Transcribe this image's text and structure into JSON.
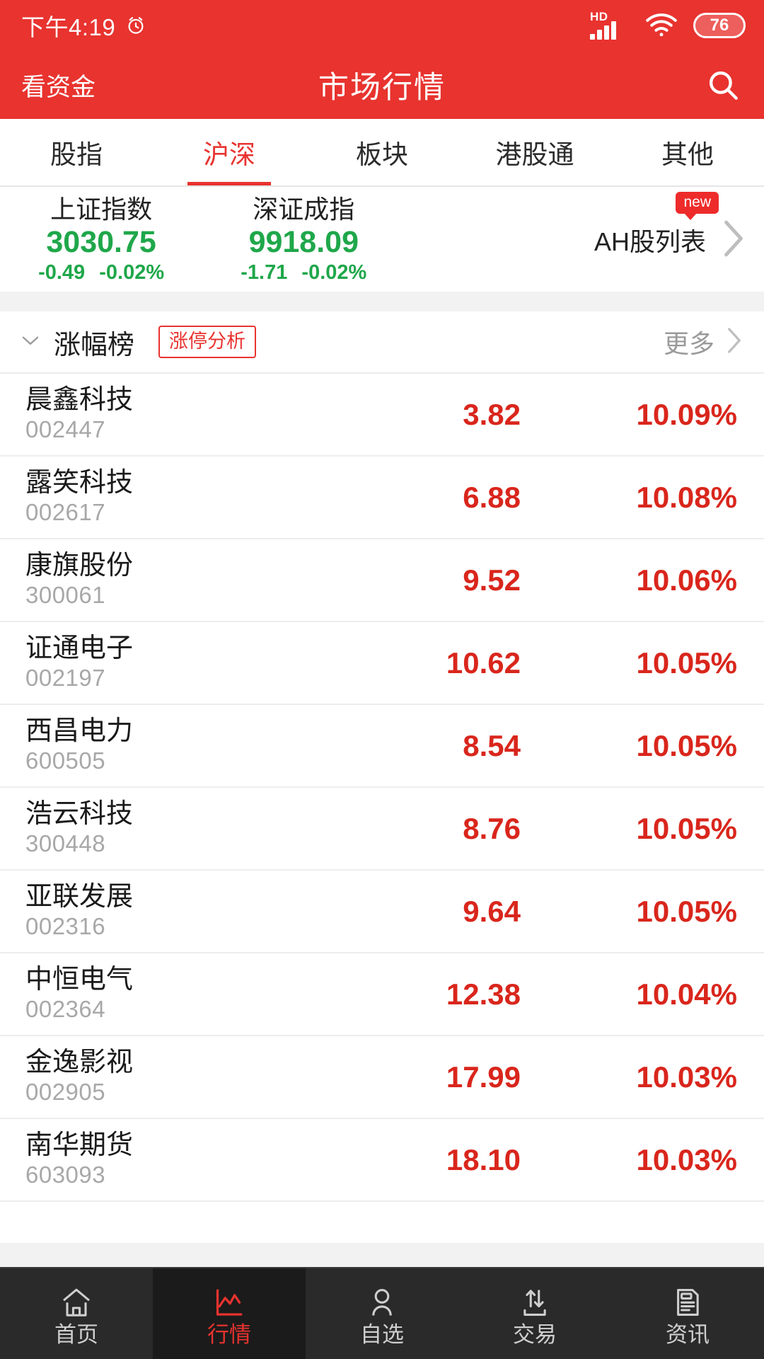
{
  "status_bar": {
    "time": "下午4:19",
    "alarm_icon": "alarm-clock-icon",
    "network_label": "HD",
    "signal_icon": "signal-bars-icon",
    "wifi_icon": "wifi-icon",
    "battery_level": "76"
  },
  "header": {
    "left_action": "看资金",
    "title": "市场行情",
    "search_icon": "search-icon",
    "background_color": "#E8332F"
  },
  "tabs": [
    {
      "label": "股指",
      "active": false
    },
    {
      "label": "沪深",
      "active": true
    },
    {
      "label": "板块",
      "active": false
    },
    {
      "label": "港股通",
      "active": false
    },
    {
      "label": "其他",
      "active": false
    }
  ],
  "indices": [
    {
      "name": "上证指数",
      "value": "3030.75",
      "change": "-0.49",
      "change_pct": "-0.02%",
      "direction": "down",
      "color": "#1FA74A"
    },
    {
      "name": "深证成指",
      "value": "9918.09",
      "change": "-1.71",
      "change_pct": "-0.02%",
      "direction": "down",
      "color": "#1FA74A"
    }
  ],
  "ah_entry": {
    "label": "AH股列表",
    "badge": "new",
    "chevron_icon": "chevron-right-icon"
  },
  "section": {
    "caret_icon": "chevron-down-icon",
    "title": "涨幅榜",
    "pill_label": "涨停分析",
    "more_label": "更多",
    "more_icon": "chevron-right-icon"
  },
  "stocks": [
    {
      "name": "晨鑫科技",
      "code": "002447",
      "price": "3.82",
      "change_pct": "10.09%"
    },
    {
      "name": "露笑科技",
      "code": "002617",
      "price": "6.88",
      "change_pct": "10.08%"
    },
    {
      "name": "康旗股份",
      "code": "300061",
      "price": "9.52",
      "change_pct": "10.06%"
    },
    {
      "name": "证通电子",
      "code": "002197",
      "price": "10.62",
      "change_pct": "10.05%"
    },
    {
      "name": "西昌电力",
      "code": "600505",
      "price": "8.54",
      "change_pct": "10.05%"
    },
    {
      "name": "浩云科技",
      "code": "300448",
      "price": "8.76",
      "change_pct": "10.05%"
    },
    {
      "name": "亚联发展",
      "code": "002316",
      "price": "9.64",
      "change_pct": "10.05%"
    },
    {
      "name": "中恒电气",
      "code": "002364",
      "price": "12.38",
      "change_pct": "10.04%"
    },
    {
      "name": "金逸影视",
      "code": "002905",
      "price": "17.99",
      "change_pct": "10.03%"
    },
    {
      "name": "南华期货",
      "code": "603093",
      "price": "18.10",
      "change_pct": "10.03%"
    }
  ],
  "bottom_nav": [
    {
      "label": "首页",
      "icon": "home-icon",
      "active": false
    },
    {
      "label": "行情",
      "icon": "chart-icon",
      "active": true
    },
    {
      "label": "自选",
      "icon": "person-icon",
      "active": false
    },
    {
      "label": "交易",
      "icon": "transfer-icon",
      "active": false
    },
    {
      "label": "资讯",
      "icon": "news-icon",
      "active": false
    }
  ],
  "colors": {
    "brand_red": "#E8332F",
    "up_red": "#D9261C",
    "down_green": "#1FA74A",
    "nav_bg": "#2A2A2A"
  }
}
